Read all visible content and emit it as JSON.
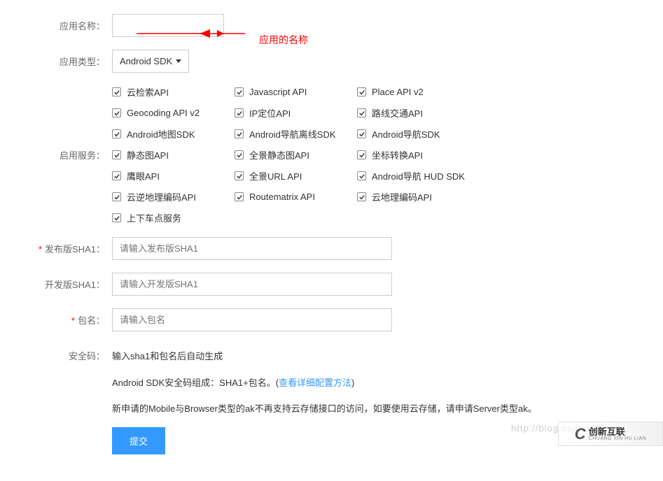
{
  "labels": {
    "app_name": "应用名称：",
    "app_type": "应用类型：",
    "services": "启用服务：",
    "release_sha1": "发布版SHA1：",
    "dev_sha1": "开发版SHA1：",
    "package_name": "包名：",
    "security_code": "安全码："
  },
  "app_type_value": "Android SDK",
  "services_list": [
    "云检索API",
    "Javascript API",
    "Place API v2",
    "Geocoding API v2",
    "IP定位API",
    "路线交通API",
    "Android地图SDK",
    "Android导航离线SDK",
    "Android导航SDK",
    "静态图API",
    "全景静态图API",
    "坐标转换API",
    "鹰眼API",
    "全景URL API",
    "Android导航 HUD SDK",
    "云逆地理编码API",
    "Routematrix API",
    "云地理编码API",
    "上下车点服务"
  ],
  "placeholders": {
    "release_sha1": "请输入发布版SHA1",
    "dev_sha1": "请输入开发版SHA1",
    "package_name": "请输入包名"
  },
  "security_hint": "输入sha1和包名后自动生成",
  "help_line1_prefix": "Android SDK安全码组成：SHA1+包名。(",
  "help_line1_link": "查看详细配置方法",
  "help_line1_suffix": ")",
  "help_line2": "新申请的Mobile与Browser类型的ak不再支持云存储接口的访问，如要使用云存储，请申请Server类型ak。",
  "submit_label": "提交",
  "annotation_text": "应用的名称",
  "watermark_url": "http://blog.csdn.n",
  "required_mark": "*",
  "logo": {
    "cn": "创新互联",
    "en": "CHUANG XIN HU LIAN"
  }
}
